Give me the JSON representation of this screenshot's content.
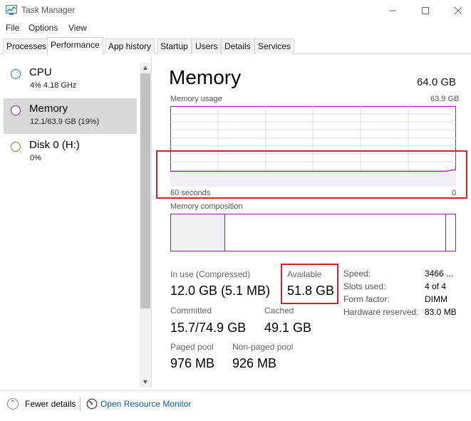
{
  "window": {
    "title": "Task Manager",
    "controls": {
      "minimize": "—",
      "maximize": "☐",
      "close": "✕"
    }
  },
  "menu": [
    "File",
    "Options",
    "View"
  ],
  "tabs": [
    "Processes",
    "Performance",
    "App history",
    "Startup",
    "Users",
    "Details",
    "Services"
  ],
  "active_tab": "Performance",
  "sidebar": {
    "items": [
      {
        "name": "CPU",
        "sub": "4% 4.18 GHz",
        "color": "#1979ca",
        "selected": false
      },
      {
        "name": "Memory",
        "sub": "12.1/63.9 GB (19%)",
        "color": "#8b1f9b",
        "selected": true
      },
      {
        "name": "Disk 0 (H:)",
        "sub": "0%",
        "color": "#4da60c",
        "selected": false
      }
    ]
  },
  "main": {
    "title": "Memory",
    "total": "64.0 GB",
    "usage_label": "Memory usage",
    "usage_max": "63.9 GB",
    "time_label": "60 seconds",
    "time_end": "0",
    "composition_label": "Memory composition",
    "usage_fraction": 0.19,
    "stats": {
      "in_use": {
        "label": "In use (Compressed)",
        "value": "12.0 GB (5.1 MB)"
      },
      "available": {
        "label": "Available",
        "value": "51.8 GB"
      },
      "committed": {
        "label": "Committed",
        "value": "15.7/74.9 GB"
      },
      "cached": {
        "label": "Cached",
        "value": "49.1 GB"
      },
      "paged_pool": {
        "label": "Paged pool",
        "value": "976 MB"
      },
      "non_paged_pool": {
        "label": "Non-paged pool",
        "value": "926 MB"
      }
    },
    "specs": [
      {
        "label": "Speed:",
        "value": "3466 ..."
      },
      {
        "label": "Slots used:",
        "value": "4 of 4"
      },
      {
        "label": "Form factor:",
        "value": "DIMM"
      },
      {
        "label": "Hardware reserved:",
        "value": "83.0 MB"
      }
    ]
  },
  "footer": {
    "fewer_details": "Fewer details",
    "open_monitor": "Open Resource Monitor"
  },
  "colors": {
    "memory_accent": "#8b1f9b",
    "highlight": "#d0232b",
    "link": "#0a5bb5"
  }
}
